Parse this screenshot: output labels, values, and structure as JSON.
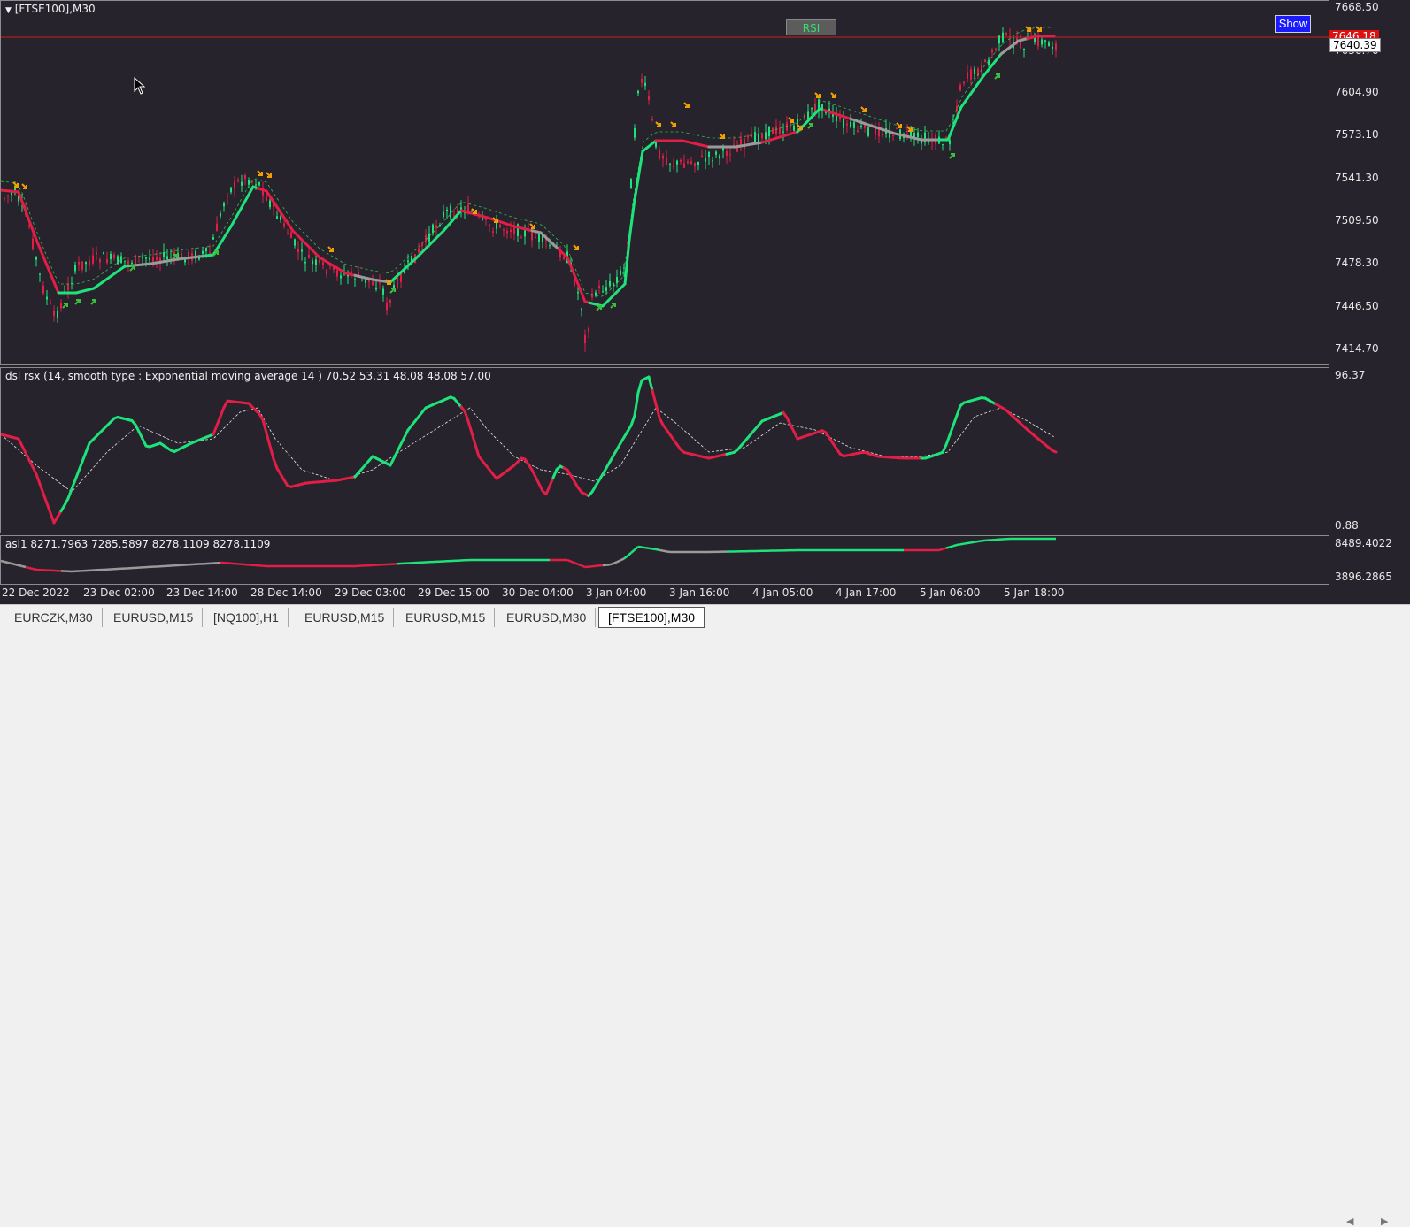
{
  "main_pane": {
    "title": "[FTSE100],M30",
    "price_labels": [
      "7668.50",
      "7636.70",
      "7604.90",
      "7573.10",
      "7541.30",
      "7509.50",
      "7478.30",
      "7446.50",
      "7414.70"
    ],
    "current_price": "7640.39",
    "bid_price": "7646.18",
    "rsi_button": "RSI",
    "show_button": "Show",
    "colors": {
      "bull": "#1ee37a",
      "bear": "#e01e46",
      "neutral": "#9a9a9a",
      "line": "#d01c1c",
      "up_arrow": "#3dbe3d",
      "down_arrow": "#f0a000"
    }
  },
  "rsx_pane": {
    "title": "dsl rsx (14, smooth type : Exponential moving average  14 ) 70.52 53.31 48.08 48.08 57.00",
    "scale_max": "96.37",
    "scale_min": "0.88"
  },
  "asi_pane": {
    "title": "asi1   8271.7963 7285.5897 8278.1109 8278.1109",
    "scale_max": "8489.4022",
    "scale_min": "3896.2865"
  },
  "time_axis": [
    "22 Dec 2022",
    "23 Dec 02:00",
    "23 Dec 14:00",
    "28 Dec 14:00",
    "29 Dec 03:00",
    "29 Dec 15:00",
    "30 Dec 04:00",
    "3 Jan 04:00",
    "3 Jan 16:00",
    "4 Jan 05:00",
    "4 Jan 17:00",
    "5 Jan 06:00",
    "5 Jan 18:00"
  ],
  "tabs": [
    {
      "label": "EURCZK,M30",
      "active": false
    },
    {
      "label": "EURUSD,M15",
      "active": false
    },
    {
      "label": "[NQ100],H1",
      "active": false
    },
    {
      "label": "EURUSD,M15",
      "active": false
    },
    {
      "label": "EURUSD,M15",
      "active": false
    },
    {
      "label": "EURUSD,M30",
      "active": false
    },
    {
      "label": "[FTSE100],M30",
      "active": true
    }
  ],
  "scroll": {
    "left_icon": "◀",
    "right_icon": "▶"
  }
}
